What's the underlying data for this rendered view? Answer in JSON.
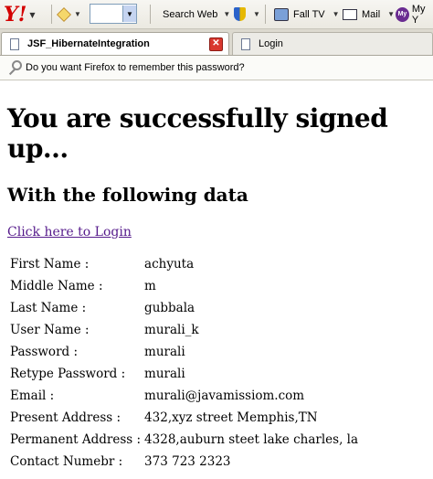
{
  "toolbar": {
    "search_web": "Search Web",
    "fall_tv": "Fall TV",
    "mail": "Mail",
    "my": "My Y"
  },
  "tabs": [
    {
      "title": "JSF_HibernateIntegration"
    },
    {
      "title": "Login"
    }
  ],
  "notification": "Do you want Firefox to remember this password?",
  "page": {
    "heading": "You are successfully signed up...",
    "subheading": "With the following data",
    "login_link": "Click here to Login"
  },
  "fields": [
    {
      "label": "First Name :",
      "value": "achyuta"
    },
    {
      "label": "Middle Name :",
      "value": "m"
    },
    {
      "label": "Last Name :",
      "value": "gubbala"
    },
    {
      "label": "User Name :",
      "value": "murali_k"
    },
    {
      "label": "Password :",
      "value": "murali"
    },
    {
      "label": "Retype Password :",
      "value": "murali"
    },
    {
      "label": "Email :",
      "value": "murali@javamissiom.com"
    },
    {
      "label": "Present Address :",
      "value": "432,xyz street Memphis,TN"
    },
    {
      "label": "Permanent Address :",
      "value": "4328,auburn steet lake charles, la"
    },
    {
      "label": "Contact Numebr :",
      "value": "373 723 2323"
    }
  ]
}
